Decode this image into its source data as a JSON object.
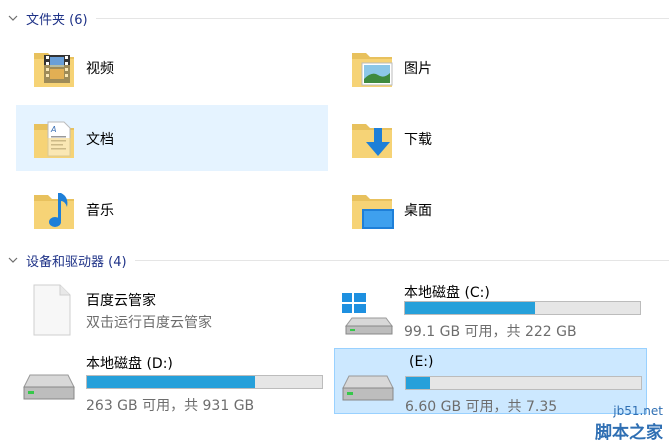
{
  "groups": {
    "folders": {
      "title": "文件夹 (6)"
    },
    "devices": {
      "title": "设备和驱动器 (4)"
    }
  },
  "folders": [
    {
      "label": "视频",
      "icon": "video-folder-icon"
    },
    {
      "label": "图片",
      "icon": "pictures-folder-icon"
    },
    {
      "label": "文档",
      "icon": "documents-folder-icon"
    },
    {
      "label": "下载",
      "icon": "downloads-folder-icon"
    },
    {
      "label": "音乐",
      "icon": "music-folder-icon"
    },
    {
      "label": "桌面",
      "icon": "desktop-folder-icon"
    }
  ],
  "drives": [
    {
      "title": "百度云管家",
      "subtitle": "双击运行百度云管家",
      "icon": "app-file-icon"
    },
    {
      "title": "本地磁盘 (C:)",
      "subtitle": "99.1 GB 可用，共 222 GB",
      "used_fraction": 0.554,
      "icon": "windows-drive-icon"
    },
    {
      "title": "本地磁盘 (D:)",
      "subtitle": "263 GB 可用，共 931 GB",
      "used_fraction": 0.717,
      "icon": "hard-drive-icon"
    },
    {
      "title": "(E:)",
      "subtitle": "6.60 GB 可用，共 7.35",
      "used_fraction": 0.102,
      "icon": "hard-drive-icon"
    }
  ],
  "watermark": {
    "url": "jb51.net",
    "name": "脚本之家"
  },
  "colors": {
    "accent": "#26a0da",
    "selection": "#e5f3ff",
    "header": "#1e3287"
  }
}
